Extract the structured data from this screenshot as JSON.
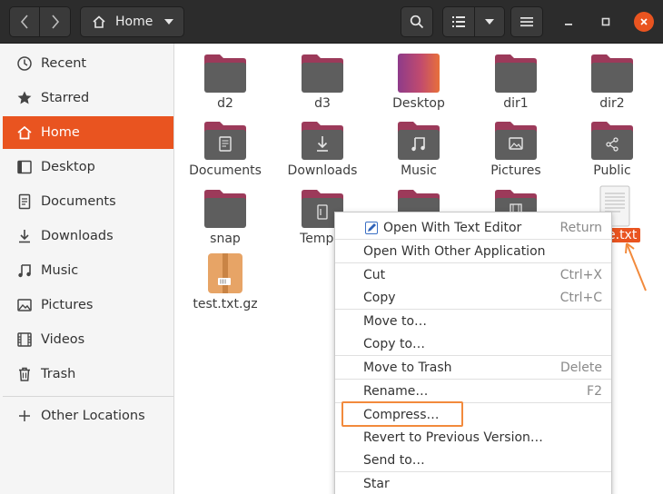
{
  "header": {
    "location": "Home",
    "icons": {
      "back": "chevron-left-icon",
      "forward": "chevron-right-icon",
      "home": "home-icon",
      "path_menu": "caret-down-icon",
      "search": "search-icon",
      "view": "list-view-icon",
      "sort": "caret-down-icon",
      "menu": "hamburger-icon",
      "minimize": "minimize-icon",
      "maximize": "maximize-icon",
      "close": "close-icon"
    }
  },
  "sidebar": {
    "items": [
      {
        "label": "Recent",
        "icon": "clock-icon"
      },
      {
        "label": "Starred",
        "icon": "star-icon"
      },
      {
        "label": "Home",
        "icon": "home-icon",
        "active": true
      },
      {
        "label": "Desktop",
        "icon": "desktop-icon"
      },
      {
        "label": "Documents",
        "icon": "document-icon"
      },
      {
        "label": "Downloads",
        "icon": "download-icon"
      },
      {
        "label": "Music",
        "icon": "music-icon"
      },
      {
        "label": "Pictures",
        "icon": "picture-icon"
      },
      {
        "label": "Videos",
        "icon": "video-icon"
      },
      {
        "label": "Trash",
        "icon": "trash-icon"
      }
    ],
    "other": {
      "label": "Other Locations",
      "icon": "plus-icon"
    }
  },
  "files": [
    {
      "name": "d2",
      "type": "folder"
    },
    {
      "name": "d3",
      "type": "folder"
    },
    {
      "name": "Desktop",
      "type": "desktop-folder"
    },
    {
      "name": "dir1",
      "type": "folder"
    },
    {
      "name": "dir2",
      "type": "folder"
    },
    {
      "name": "Documents",
      "type": "folder-documents"
    },
    {
      "name": "Downloads",
      "type": "folder-downloads"
    },
    {
      "name": "Music",
      "type": "folder-music"
    },
    {
      "name": "Pictures",
      "type": "folder-pictures"
    },
    {
      "name": "Public",
      "type": "folder-public"
    },
    {
      "name": "snap",
      "type": "folder"
    },
    {
      "name": "Templa",
      "type": "folder-templates"
    },
    {
      "name": "",
      "type": "folder"
    },
    {
      "name": "",
      "type": "folder-videos"
    },
    {
      "name": "e.txt",
      "type": "text-file",
      "selected": true
    },
    {
      "name": "test.txt.gz",
      "type": "archive"
    }
  ],
  "context_menu": {
    "items": [
      {
        "label": "Open With Text Editor",
        "accel": "Return",
        "icon": "text-editor-icon"
      },
      {
        "label": "Open With Other Application",
        "accel": ""
      },
      {
        "label": "Cut",
        "accel": "Ctrl+X"
      },
      {
        "label": "Copy",
        "accel": "Ctrl+C"
      },
      {
        "label": "Move to…",
        "accel": ""
      },
      {
        "label": "Copy to…",
        "accel": ""
      },
      {
        "label": "Move to Trash",
        "accel": "Delete"
      },
      {
        "label": "Rename…",
        "accel": "F2"
      },
      {
        "label": "Compress…",
        "accel": "",
        "highlighted": true
      },
      {
        "label": "Revert to Previous Version…",
        "accel": ""
      },
      {
        "label": "Send to…",
        "accel": ""
      },
      {
        "label": "Star",
        "accel": ""
      }
    ]
  },
  "colors": {
    "accent": "#e95420",
    "folder_body": "#5e5e5e",
    "folder_tab": "#9c3a5a",
    "highlight_box": "#f28a3c"
  }
}
